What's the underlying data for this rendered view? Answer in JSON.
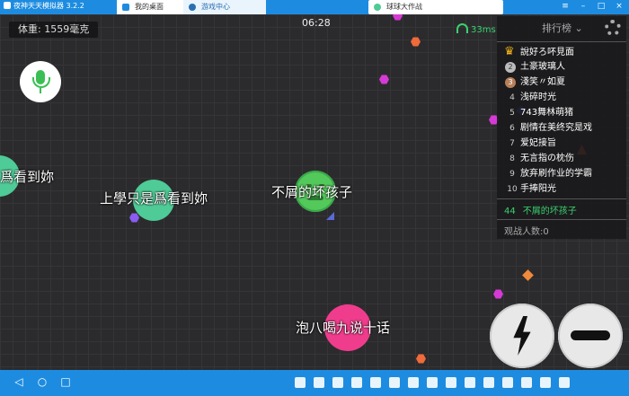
{
  "window": {
    "app_title": "夜神天天模拟器 3.2.2",
    "tabs": [
      {
        "label": "我的桌面"
      },
      {
        "label": "游戏中心"
      },
      {
        "label": "球球大作战"
      }
    ]
  },
  "hud": {
    "weight": "体重: 1559毫克",
    "clock": "06:28",
    "ping": "33ms"
  },
  "leaderboard": {
    "title": "排行榜",
    "rows": [
      {
        "rank": "",
        "name": "說好ろ吥見面"
      },
      {
        "rank": "2",
        "name": "土豪玻璃人"
      },
      {
        "rank": "3",
        "name": "淺笑〃如夏"
      },
      {
        "rank": "4",
        "name": "浅碎时光"
      },
      {
        "rank": "5",
        "name": "743舞林萌猪"
      },
      {
        "rank": "6",
        "name": "剧情在美终究是戏"
      },
      {
        "rank": "7",
        "name": "爱妃接旨"
      },
      {
        "rank": "8",
        "name": "无言指の枕伤"
      },
      {
        "rank": "9",
        "name": "放弃刷作业的学霸"
      },
      {
        "rank": "10",
        "name": "手捧阳光"
      }
    ],
    "self_rank": "44",
    "self_name": "不屑的坏孩子",
    "viewers": "观战人数:0"
  },
  "cells": {
    "left_edge": "爲看到妳",
    "teal": "上學只是爲看到妳",
    "player": "不屑的坏孩子",
    "pink": "泡八喝九说十话"
  },
  "colors": {
    "accent": "#1d8ce0",
    "teal_cell": "#4ecb96",
    "player_cell": "#52c95a",
    "pink_cell": "#f03c8c",
    "ping_green": "#3bd16f"
  }
}
